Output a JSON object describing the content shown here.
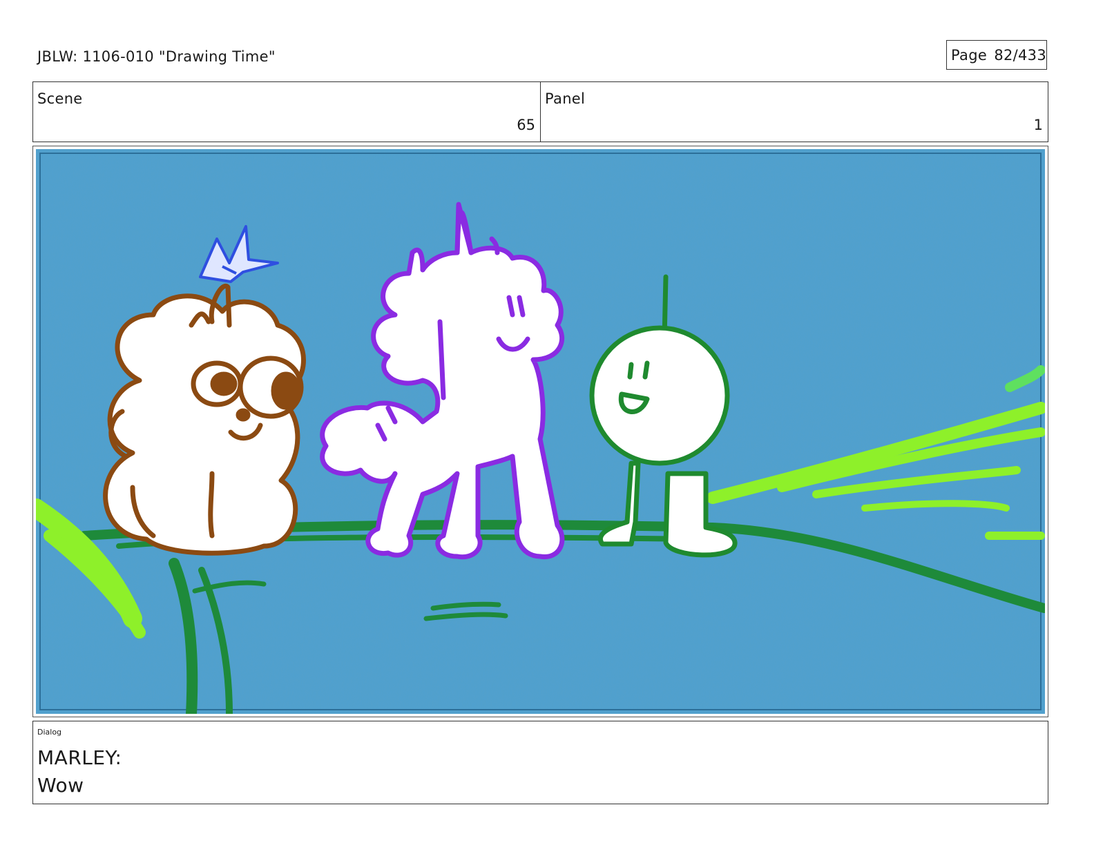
{
  "header": {
    "title": "JBLW: 1106-010 \"Drawing Time\"",
    "page_label": "Page",
    "page_number": "82/433"
  },
  "info": {
    "scene_label": "Scene",
    "scene_value": "65",
    "panel_label": "Panel",
    "panel_value": "1"
  },
  "panel_image": {
    "background_color": "#4fa0cf",
    "characters": [
      "brown-bear",
      "purple-unicorn",
      "green-sprout-kid"
    ],
    "colors": {
      "bear": "#8b4a12",
      "unicorn": "#8a2be2",
      "kid": "#1f8a2f",
      "grass": "#8ef02a",
      "crane": "#2f4fe0"
    }
  },
  "dialog": {
    "label": "Dialog",
    "speaker": "MARLEY:",
    "line": "Wow"
  }
}
